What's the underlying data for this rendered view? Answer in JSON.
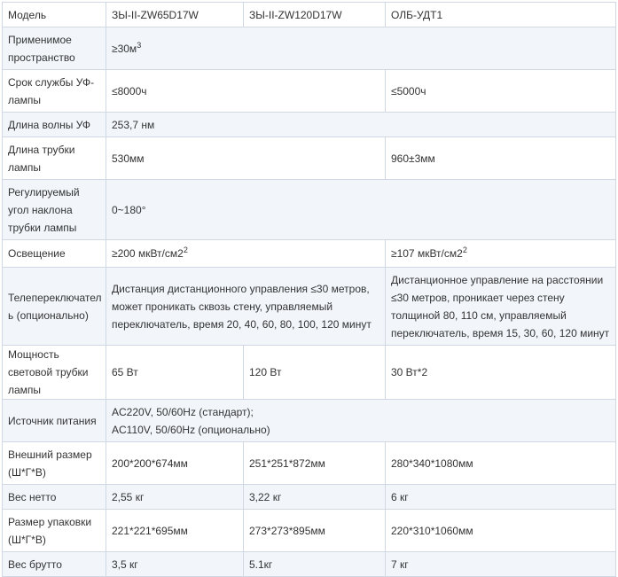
{
  "table": {
    "rows": {
      "model": {
        "label": "Модель",
        "c1": "ЗЫ-II-ZW65D17W",
        "c2": "ЗЫ-II-ZW120D17W",
        "c3": "ОЛБ-УДТ1"
      },
      "space": {
        "label": "Применимое пространство",
        "value_prefix": "≥30м",
        "value_sup": "3"
      },
      "lamp_life": {
        "label": "Срок службы УФ-лампы",
        "c12": "≤8000ч",
        "c3": "≤5000ч"
      },
      "wavelength": {
        "label": "Длина волны УФ",
        "value": "253,7 нм"
      },
      "tube_length": {
        "label": "Длина трубки лампы",
        "c12": "530мм",
        "c3": "960±3мм"
      },
      "tilt": {
        "label": "Регулируемый угол наклона трубки лампы",
        "value": "0~180°"
      },
      "irradiance": {
        "label": "Освещение",
        "c12_prefix": "≥200 мкВт/см2",
        "c12_sup": "2",
        "c3_prefix": "≥107 мкВт/см2",
        "c3_sup": "2"
      },
      "remote": {
        "label": "Телепереключатель (опционально)",
        "c12": "Дистанция дистанционного управления ≤30 метров, может проникать сквозь стену, управляемый переключатель, время 20, 40, 60, 80, 100, 120 минут",
        "c3": "Дистанционное управление на расстоянии ≤30 метров, проникает через стену толщиной 80, 110 см, управляемый переключатель, время 15, 30, 60, 120 минут"
      },
      "power": {
        "label": "Мощность световой трубки лампы",
        "c1": "65 Вт",
        "c2": "120 Вт",
        "c3": "30 Вт*2"
      },
      "supply": {
        "label": "Источник питания",
        "line1": "AC220V, 50/60Hz (стандарт);",
        "line2": "AC110V, 50/60Hz (опционально)"
      },
      "outer_size": {
        "label": "Внешний размер (Ш*Г*В)",
        "c1": "200*200*674мм",
        "c2": "251*251*872мм",
        "c3": "280*340*1080мм"
      },
      "net_weight": {
        "label": "Вес нетто",
        "c1": "2,55 кг",
        "c2": "3,22 кг",
        "c3": "6 кг"
      },
      "pack_size": {
        "label": "Размер упаковки (Ш*Г*В)",
        "c1": "221*221*695мм",
        "c2": "273*273*895мм",
        "c3": "220*310*1060мм"
      },
      "gross_weight": {
        "label": "Вес брутто",
        "c1": "3,5 кг",
        "c2": "5.1кг",
        "c3": "7 кг"
      }
    }
  }
}
